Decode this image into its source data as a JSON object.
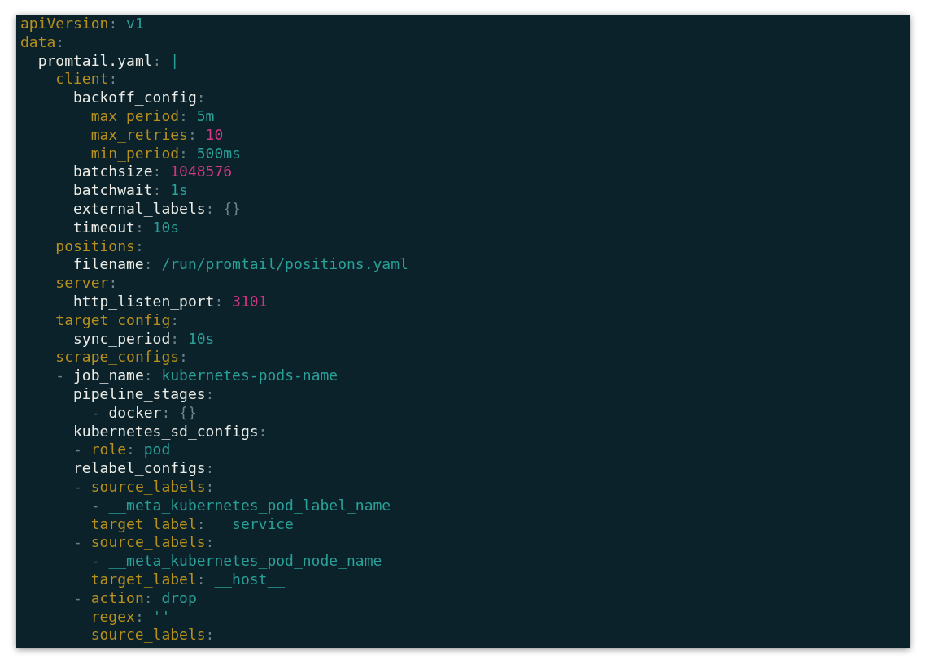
{
  "editor": {
    "lines": [
      {
        "kind": "plain",
        "tokens": [
          {
            "kind": "key",
            "text": "apiVersion"
          },
          {
            "kind": "colon",
            "text": ": "
          },
          {
            "kind": "string",
            "text": "v1"
          }
        ]
      },
      {
        "kind": "plain",
        "tokens": [
          {
            "kind": "key",
            "text": "data"
          },
          {
            "kind": "colon",
            "text": ":"
          }
        ],
        "children": [
          {
            "kind": "plain",
            "tokens": [
              {
                "kind": "nested_key",
                "text": "promtail.yaml"
              },
              {
                "kind": "colon",
                "text": ": "
              },
              {
                "kind": "string",
                "text": "|"
              }
            ],
            "children": [
              {
                "kind": "plain",
                "tokens": [
                  {
                    "kind": "key",
                    "text": "client"
                  },
                  {
                    "kind": "colon",
                    "text": ":"
                  }
                ],
                "children": [
                  {
                    "kind": "plain",
                    "tokens": [
                      {
                        "kind": "nested_key",
                        "text": "backoff_config"
                      },
                      {
                        "kind": "colon",
                        "text": ":"
                      }
                    ],
                    "children": [
                      {
                        "kind": "plain",
                        "tokens": [
                          {
                            "kind": "key",
                            "text": "max_period"
                          },
                          {
                            "kind": "colon",
                            "text": ": "
                          },
                          {
                            "kind": "string",
                            "text": "5m"
                          }
                        ]
                      },
                      {
                        "kind": "plain",
                        "tokens": [
                          {
                            "kind": "key",
                            "text": "max_retries"
                          },
                          {
                            "kind": "colon",
                            "text": ": "
                          },
                          {
                            "kind": "number",
                            "text": "10"
                          }
                        ]
                      },
                      {
                        "kind": "plain",
                        "tokens": [
                          {
                            "kind": "key",
                            "text": "min_period"
                          },
                          {
                            "kind": "colon",
                            "text": ": "
                          },
                          {
                            "kind": "string",
                            "text": "500ms"
                          }
                        ]
                      }
                    ]
                  },
                  {
                    "kind": "plain",
                    "tokens": [
                      {
                        "kind": "nested_key",
                        "text": "batchsize"
                      },
                      {
                        "kind": "colon",
                        "text": ": "
                      },
                      {
                        "kind": "number",
                        "text": "1048576"
                      }
                    ]
                  },
                  {
                    "kind": "plain",
                    "tokens": [
                      {
                        "kind": "nested_key",
                        "text": "batchwait"
                      },
                      {
                        "kind": "colon",
                        "text": ": "
                      },
                      {
                        "kind": "string",
                        "text": "1s"
                      }
                    ]
                  },
                  {
                    "kind": "plain",
                    "tokens": [
                      {
                        "kind": "nested_key",
                        "text": "external_labels"
                      },
                      {
                        "kind": "colon",
                        "text": ": "
                      },
                      {
                        "kind": "punct",
                        "text": "{}"
                      }
                    ]
                  },
                  {
                    "kind": "plain",
                    "tokens": [
                      {
                        "kind": "nested_key",
                        "text": "timeout"
                      },
                      {
                        "kind": "colon",
                        "text": ": "
                      },
                      {
                        "kind": "string",
                        "text": "10s"
                      }
                    ]
                  }
                ]
              },
              {
                "kind": "plain",
                "tokens": [
                  {
                    "kind": "key",
                    "text": "positions"
                  },
                  {
                    "kind": "colon",
                    "text": ":"
                  }
                ],
                "children": [
                  {
                    "kind": "plain",
                    "tokens": [
                      {
                        "kind": "nested_key",
                        "text": "filename"
                      },
                      {
                        "kind": "colon",
                        "text": ": "
                      },
                      {
                        "kind": "string",
                        "text": "/run/promtail/positions.yaml"
                      }
                    ]
                  }
                ]
              },
              {
                "kind": "plain",
                "tokens": [
                  {
                    "kind": "key",
                    "text": "server"
                  },
                  {
                    "kind": "colon",
                    "text": ":"
                  }
                ],
                "children": [
                  {
                    "kind": "plain",
                    "tokens": [
                      {
                        "kind": "nested_key",
                        "text": "http_listen_port"
                      },
                      {
                        "kind": "colon",
                        "text": ": "
                      },
                      {
                        "kind": "number",
                        "text": "3101"
                      }
                    ]
                  }
                ]
              },
              {
                "kind": "plain",
                "tokens": [
                  {
                    "kind": "key",
                    "text": "target_config"
                  },
                  {
                    "kind": "colon",
                    "text": ":"
                  }
                ],
                "children": [
                  {
                    "kind": "plain",
                    "tokens": [
                      {
                        "kind": "nested_key",
                        "text": "sync_period"
                      },
                      {
                        "kind": "colon",
                        "text": ": "
                      },
                      {
                        "kind": "string",
                        "text": "10s"
                      }
                    ]
                  }
                ]
              },
              {
                "kind": "plain",
                "tokens": [
                  {
                    "kind": "key",
                    "text": "scrape_configs"
                  },
                  {
                    "kind": "colon",
                    "text": ":"
                  }
                ],
                "children": [
                  {
                    "kind": "hanging",
                    "tokens": [
                      {
                        "kind": "dash",
                        "text": "- "
                      },
                      {
                        "kind": "nested_key",
                        "text": "job_name"
                      },
                      {
                        "kind": "colon",
                        "text": ": "
                      },
                      {
                        "kind": "string",
                        "text": "kubernetes-pods-name"
                      }
                    ]
                  },
                  {
                    "kind": "plain",
                    "tokens": [
                      {
                        "kind": "nested_key",
                        "text": "pipeline_stages"
                      },
                      {
                        "kind": "colon",
                        "text": ":"
                      }
                    ],
                    "children": [
                      {
                        "kind": "plain",
                        "tokens": [
                          {
                            "kind": "dash",
                            "text": "- "
                          },
                          {
                            "kind": "nested_key",
                            "text": "docker"
                          },
                          {
                            "kind": "colon",
                            "text": ": "
                          },
                          {
                            "kind": "punct",
                            "text": "{}"
                          }
                        ]
                      }
                    ]
                  },
                  {
                    "kind": "plain",
                    "tokens": [
                      {
                        "kind": "nested_key",
                        "text": "kubernetes_sd_configs"
                      },
                      {
                        "kind": "colon",
                        "text": ":"
                      }
                    ],
                    "children": [
                      {
                        "kind": "hanging",
                        "tokens": [
                          {
                            "kind": "dash",
                            "text": "- "
                          },
                          {
                            "kind": "key",
                            "text": "role"
                          },
                          {
                            "kind": "colon",
                            "text": ": "
                          },
                          {
                            "kind": "string",
                            "text": "pod"
                          }
                        ]
                      }
                    ]
                  },
                  {
                    "kind": "plain",
                    "tokens": [
                      {
                        "kind": "nested_key",
                        "text": "relabel_configs"
                      },
                      {
                        "kind": "colon",
                        "text": ":"
                      }
                    ],
                    "children": [
                      {
                        "kind": "hanging",
                        "tokens": [
                          {
                            "kind": "dash",
                            "text": "- "
                          },
                          {
                            "kind": "key",
                            "text": "source_labels"
                          },
                          {
                            "kind": "colon",
                            "text": ":"
                          }
                        ],
                        "children": [
                          {
                            "kind": "hanging",
                            "tokens": [
                              {
                                "kind": "dash",
                                "text": "- "
                              },
                              {
                                "kind": "string",
                                "text": "__meta_kubernetes_pod_label_name"
                              }
                            ]
                          }
                        ]
                      },
                      {
                        "kind": "plain",
                        "tokens": [
                          {
                            "kind": "key",
                            "text": "target_label"
                          },
                          {
                            "kind": "colon",
                            "text": ": "
                          },
                          {
                            "kind": "string",
                            "text": "__service__"
                          }
                        ]
                      },
                      {
                        "kind": "hanging",
                        "tokens": [
                          {
                            "kind": "dash",
                            "text": "- "
                          },
                          {
                            "kind": "key",
                            "text": "source_labels"
                          },
                          {
                            "kind": "colon",
                            "text": ":"
                          }
                        ],
                        "children": [
                          {
                            "kind": "hanging",
                            "tokens": [
                              {
                                "kind": "dash",
                                "text": "- "
                              },
                              {
                                "kind": "string",
                                "text": "__meta_kubernetes_pod_node_name"
                              }
                            ]
                          }
                        ]
                      },
                      {
                        "kind": "plain",
                        "tokens": [
                          {
                            "kind": "key",
                            "text": "target_label"
                          },
                          {
                            "kind": "colon",
                            "text": ": "
                          },
                          {
                            "kind": "string",
                            "text": "__host__"
                          }
                        ]
                      },
                      {
                        "kind": "hanging",
                        "tokens": [
                          {
                            "kind": "dash",
                            "text": "- "
                          },
                          {
                            "kind": "key",
                            "text": "action"
                          },
                          {
                            "kind": "colon",
                            "text": ": "
                          },
                          {
                            "kind": "string",
                            "text": "drop"
                          }
                        ]
                      },
                      {
                        "kind": "plain",
                        "tokens": [
                          {
                            "kind": "key",
                            "text": "regex"
                          },
                          {
                            "kind": "colon",
                            "text": ": "
                          },
                          {
                            "kind": "string",
                            "text": "''"
                          }
                        ]
                      },
                      {
                        "kind": "plain",
                        "tokens": [
                          {
                            "kind": "key",
                            "text": "source_labels"
                          },
                          {
                            "kind": "colon",
                            "text": ":"
                          }
                        ]
                      }
                    ]
                  }
                ]
              }
            ]
          }
        ]
      }
    ]
  }
}
